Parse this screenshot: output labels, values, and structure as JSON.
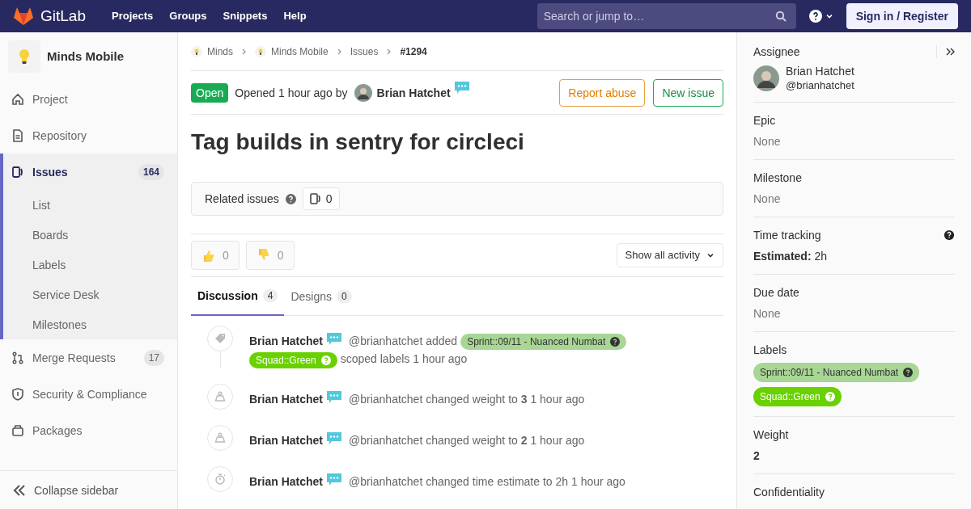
{
  "header": {
    "brand": "GitLab",
    "nav": [
      "Projects",
      "Groups",
      "Snippets",
      "Help"
    ],
    "search": {
      "placeholder": "Search or jump to…"
    },
    "sign_in": "Sign in / Register"
  },
  "sidebar": {
    "project": "Minds Mobile",
    "items": [
      {
        "label": "Project",
        "selected": false
      },
      {
        "label": "Repository",
        "selected": false
      },
      {
        "label": "Issues",
        "count": "164",
        "selected": true,
        "children": [
          {
            "label": "List"
          },
          {
            "label": "Boards"
          },
          {
            "label": "Labels"
          },
          {
            "label": "Service Desk"
          },
          {
            "label": "Milestones"
          }
        ]
      },
      {
        "label": "Merge Requests",
        "count": "17",
        "selected": false
      },
      {
        "label": "Security & Compliance",
        "selected": false
      },
      {
        "label": "Packages",
        "selected": false
      }
    ],
    "collapse": "Collapse sidebar"
  },
  "breadcrumbs": [
    {
      "label": "Minds"
    },
    {
      "label": "Minds Mobile"
    },
    {
      "label": "Issues"
    },
    {
      "label": "#1294"
    }
  ],
  "issue": {
    "status": "Open",
    "opened": "Opened 1 hour ago by",
    "author": "Brian Hatchet",
    "title": "Tag builds in sentry for circleci",
    "actions": [
      {
        "label": "Report abuse",
        "kind": "warning"
      },
      {
        "label": "New issue",
        "kind": "success"
      }
    ]
  },
  "related": {
    "label": "Related issues",
    "count": "0"
  },
  "awards": [
    {
      "kind": "thumbsup",
      "count": "0"
    },
    {
      "kind": "thumbsdown",
      "count": "0"
    }
  ],
  "activity_filter": "Show all activity",
  "tabs": [
    {
      "label": "Discussion",
      "count": "4",
      "selected": true
    },
    {
      "label": "Designs",
      "count": "0",
      "selected": false
    }
  ],
  "events": [
    {
      "kind": "labels",
      "author": "Brian Hatchet",
      "segments": [
        {
          "kind": "text",
          "text": "@brianhatchet added"
        },
        {
          "kind": "label",
          "text": "Sprint::09/11 - Nuanced Numbat",
          "color": "#a8d695"
        },
        {
          "kind": "label",
          "text": "Squad::Green",
          "color": "#69d100"
        },
        {
          "kind": "text",
          "text": "scoped labels 1 hour ago"
        }
      ]
    },
    {
      "kind": "weight",
      "author": "Brian Hatchet",
      "segments": [
        {
          "kind": "text",
          "text": "@brianhatchet changed weight to **3** 1 hour ago"
        }
      ]
    },
    {
      "kind": "weight",
      "author": "Brian Hatchet",
      "segments": [
        {
          "kind": "text",
          "text": "@brianhatchet changed weight to **2** 1 hour ago"
        }
      ]
    },
    {
      "kind": "estimate",
      "author": "Brian Hatchet",
      "segments": [
        {
          "kind": "text",
          "text": "@brianhatchet changed time estimate to 2h 1 hour ago"
        }
      ]
    }
  ],
  "right_sidebar": {
    "sections": [
      {
        "kind": "assignee",
        "title": "Assignee",
        "name": "Brian Hatchet",
        "username": "@brianhatchet"
      },
      {
        "kind": "empty",
        "title": "Epic",
        "value": "None"
      },
      {
        "kind": "empty",
        "title": "Milestone",
        "value": "None"
      },
      {
        "kind": "time",
        "title": "Time tracking",
        "key": "Estimated:",
        "value": "2h"
      },
      {
        "kind": "empty",
        "title": "Due date",
        "value": "None"
      },
      {
        "kind": "labels",
        "title": "Labels",
        "labels": [
          {
            "text": "Sprint::09/11 - Nuanced Numbat",
            "color": "#a8d695"
          },
          {
            "text": "Squad::Green",
            "color": "#69d100"
          }
        ]
      },
      {
        "kind": "value",
        "title": "Weight",
        "value": "2"
      },
      {
        "kind": "title",
        "title": "Confidentiality"
      }
    ]
  }
}
